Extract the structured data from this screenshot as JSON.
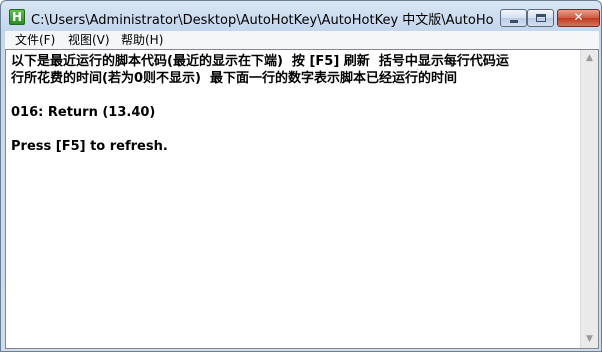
{
  "window": {
    "title": "C:\\Users\\Administrator\\Desktop\\AutoHotKey\\AutoHotKey 中文版\\AutoHotKey...",
    "icon_letter": "H"
  },
  "caption_buttons": {
    "minimize": "minimize-icon",
    "maximize": "maximize-icon",
    "close": "close-icon"
  },
  "menu": {
    "items": [
      "文件(F)",
      "视图(V)",
      "帮助(H)"
    ]
  },
  "content": {
    "lines": [
      "以下是最近运行的脚本代码(最近的显示在下端)  按 [F5] 刷新  括号中显示每行代码运",
      "行所花费的时间(若为0则不显示)  最下面一行的数字表示脚本已经运行的时间",
      "",
      "016: Return (13.40)",
      "",
      "Press [F5] to refresh."
    ]
  },
  "scrollbar": {
    "up_arrow": "▲",
    "down_arrow": "▼"
  }
}
